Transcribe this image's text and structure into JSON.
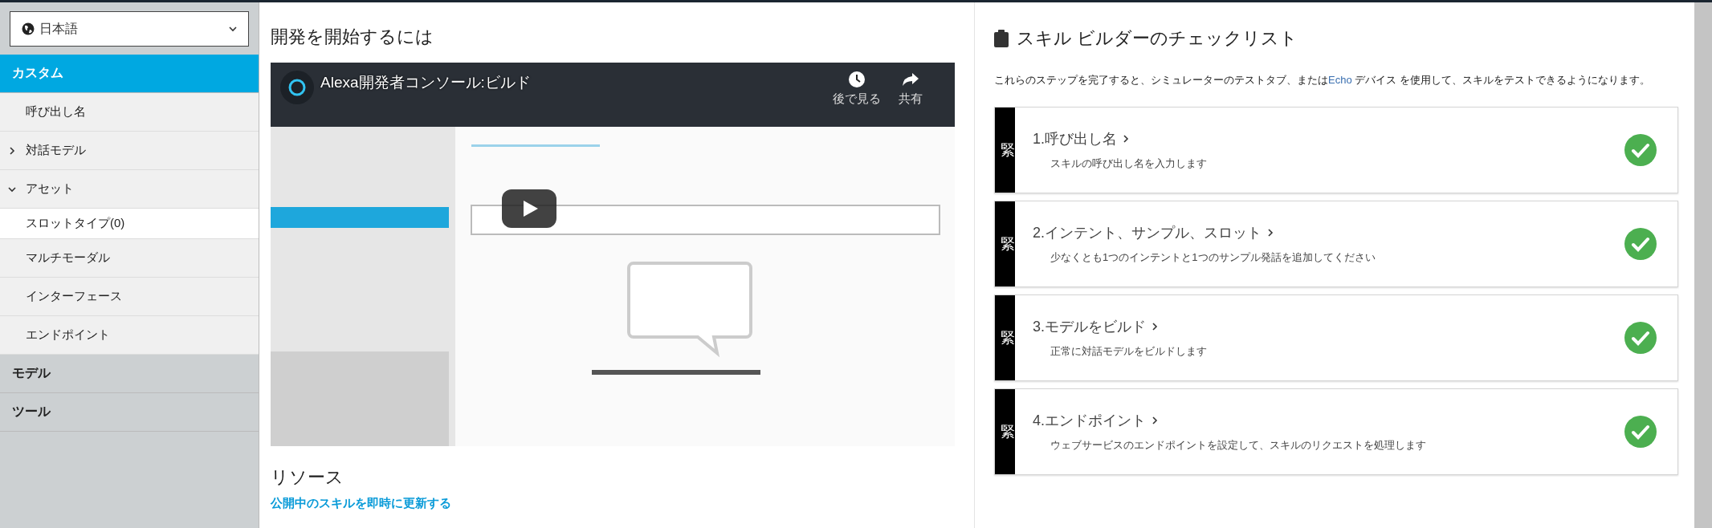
{
  "language_select": {
    "value": "日本語"
  },
  "sidebar": {
    "sections": [
      {
        "label": "カスタム",
        "selected": true,
        "items": [
          {
            "kind": "link",
            "label": "呼び出し名",
            "selected": false
          },
          {
            "kind": "group",
            "label": "対話モデル",
            "expanded": false,
            "selected": false
          },
          {
            "kind": "group",
            "label": "アセット",
            "expanded": true,
            "selected": false,
            "children": [
              {
                "kind": "link",
                "label": "スロットタイプ(0)",
                "selected": true
              }
            ]
          },
          {
            "kind": "link",
            "label": "マルチモーダル",
            "selected": false
          },
          {
            "kind": "link",
            "label": "インターフェース",
            "selected": false
          },
          {
            "kind": "link",
            "label": "エンドポイント",
            "selected": false
          }
        ]
      },
      {
        "label": "モデル",
        "selected": false
      },
      {
        "label": "ツール",
        "selected": false
      }
    ]
  },
  "getting_started": {
    "title": "開発を開始するには",
    "video": {
      "kind": "picture",
      "title": "Alexa開発者コンソール:ビルド",
      "actions": [
        {
          "kind": "clock",
          "label": "後で見る"
        },
        {
          "kind": "share",
          "label": "共有"
        }
      ]
    }
  },
  "resources": {
    "title": "リソース",
    "links": [
      "公開中のスキルを即時に更新する"
    ]
  },
  "checklist": {
    "title": "スキル ビルダーのチェックリスト",
    "description": {
      "before": "これらのステップを完了すると、シミュレーターのテストタブ、または",
      "link": "Echo",
      "after": " デバイス を使用して、スキルをテストできるようになります。"
    },
    "steps": [
      {
        "status_label": "緊",
        "title": "1.呼び出し名",
        "description": "スキルの呼び出し名を入力します",
        "completed": true
      },
      {
        "status_label": "緊",
        "title": "2.インテント、サンプル、スロット",
        "description": "少なくとも1つのインテントと1つのサンプル発話を追加してください",
        "completed": true
      },
      {
        "status_label": "緊",
        "title": "3.モデルをビルド",
        "description": "正常に対話モデルをビルドします",
        "completed": true
      },
      {
        "status_label": "緊",
        "title": "4.エンドポイント",
        "description": "ウェブサービスのエンドポイントを設定して、スキルのリクエストを処理します",
        "completed": true
      }
    ]
  }
}
